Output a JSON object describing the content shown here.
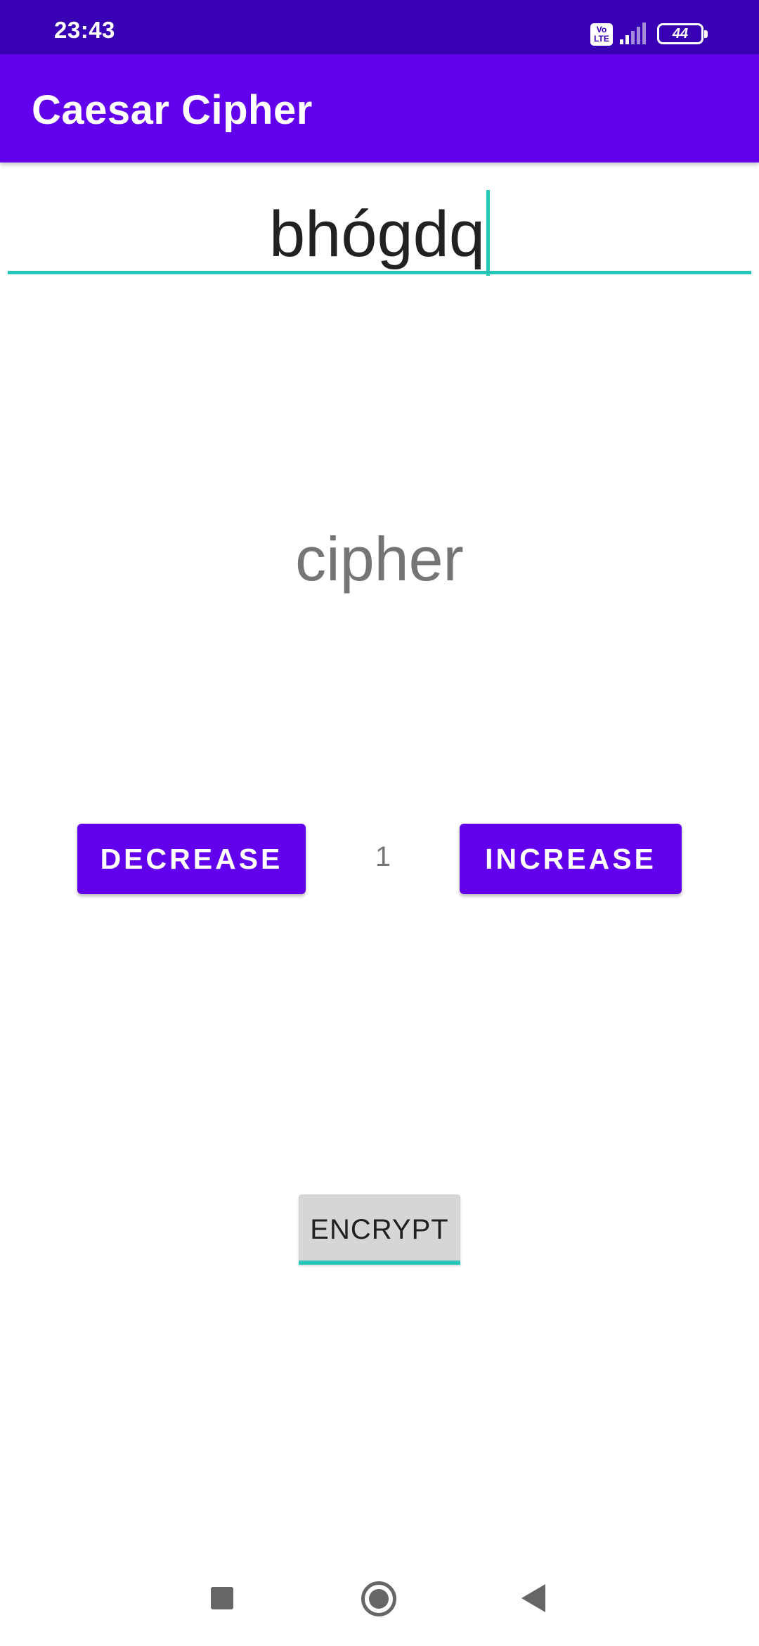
{
  "status_bar": {
    "time": "23:43",
    "volte_label": "Vo LTE",
    "battery_level": "44",
    "icons": [
      "volte-icon",
      "signal-icon",
      "battery-icon"
    ]
  },
  "app_bar": {
    "title": "Caesar Cipher"
  },
  "input": {
    "value": "bhógdq"
  },
  "output": {
    "text": "cipher"
  },
  "shift_controls": {
    "decrease_label": "DECREASE",
    "increase_label": "INCREASE",
    "shift_value": "1"
  },
  "encrypt": {
    "label": "ENCRYPT"
  },
  "nav_bar": {
    "icons": [
      "recents-icon",
      "home-icon",
      "back-icon"
    ]
  },
  "colors": {
    "status_bar": "#3700B3",
    "primary": "#6200EE",
    "accent": "#26C6B8",
    "secondary_text": "#757575"
  }
}
